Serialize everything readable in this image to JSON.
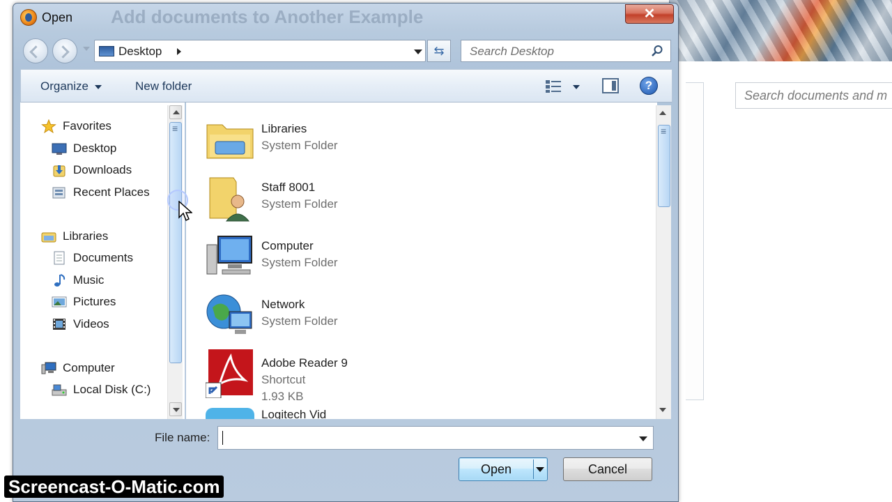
{
  "background": {
    "search_placeholder": "Search documents and m"
  },
  "dialog": {
    "title": "Open",
    "background_title_ghost": "Add documents to Another Example",
    "close_label": "✕"
  },
  "address_bar": {
    "location": "Desktop"
  },
  "search": {
    "placeholder": "Search Desktop"
  },
  "toolbar": {
    "organize_label": "Organize",
    "new_folder_label": "New folder",
    "help_label": "?"
  },
  "nav_pane": {
    "items": [
      {
        "label": "Favorites",
        "icon": "star-icon"
      },
      {
        "label": "Desktop",
        "icon": "desktop-icon"
      },
      {
        "label": "Downloads",
        "icon": "downloads-icon"
      },
      {
        "label": "Recent Places",
        "icon": "recent-places-icon"
      },
      {
        "label": "Libraries",
        "icon": "libraries-icon"
      },
      {
        "label": "Documents",
        "icon": "documents-icon"
      },
      {
        "label": "Music",
        "icon": "music-icon"
      },
      {
        "label": "Pictures",
        "icon": "pictures-icon"
      },
      {
        "label": "Videos",
        "icon": "videos-icon"
      },
      {
        "label": "Computer",
        "icon": "computer-icon"
      },
      {
        "label": "Local Disk (C:)",
        "icon": "local-disk-icon"
      }
    ]
  },
  "files": [
    {
      "name": "Libraries",
      "type": "System Folder",
      "icon": "libraries-folder-icon"
    },
    {
      "name": "Staff 8001",
      "type": "System Folder",
      "icon": "user-folder-icon"
    },
    {
      "name": "Computer",
      "type": "System Folder",
      "icon": "computer-icon"
    },
    {
      "name": "Network",
      "type": "System Folder",
      "icon": "network-icon"
    },
    {
      "name": "Adobe Reader 9",
      "type": "Shortcut",
      "size": "1.93 KB",
      "icon": "adobe-reader-icon"
    },
    {
      "name": "Logitech Vid",
      "icon": "logitech-icon"
    }
  ],
  "bottom": {
    "file_name_label": "File name:",
    "file_name_value": "",
    "open_label": "Open",
    "cancel_label": "Cancel"
  },
  "watermark": "Screencast-O-Matic.com"
}
